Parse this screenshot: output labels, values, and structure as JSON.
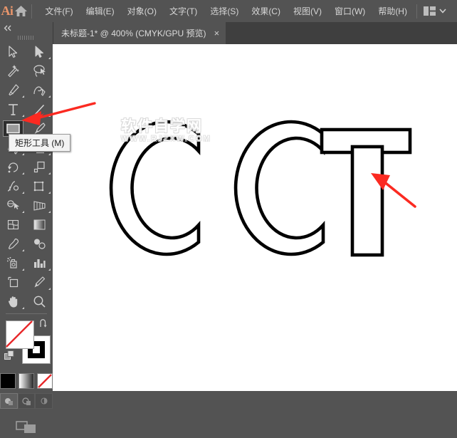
{
  "app": {
    "name": "Adobe Illustrator",
    "logo_text": "Ai",
    "home_icon": "home-icon"
  },
  "menubar": {
    "items": [
      {
        "label": "文件(F)",
        "name": "menu-file"
      },
      {
        "label": "编辑(E)",
        "name": "menu-edit"
      },
      {
        "label": "对象(O)",
        "name": "menu-object"
      },
      {
        "label": "文字(T)",
        "name": "menu-type"
      },
      {
        "label": "选择(S)",
        "name": "menu-select"
      },
      {
        "label": "效果(C)",
        "name": "menu-effect"
      },
      {
        "label": "视图(V)",
        "name": "menu-view"
      },
      {
        "label": "窗口(W)",
        "name": "menu-window"
      },
      {
        "label": "帮助(H)",
        "name": "menu-help"
      }
    ],
    "workspace_switcher_icon": "workspace-layout-icon",
    "workspace_chevron_icon": "chevron-down-icon"
  },
  "tabbar": {
    "document_title": "未标题-1* @ 400% (CMYK/GPU 预览)",
    "close_label": "×"
  },
  "toolpanel": {
    "collapse_icon": "double-chevron-left-icon",
    "grip_icon": "panel-grip-icon",
    "tools": [
      {
        "name": "selection-tool",
        "icon": "arrow-cursor-icon",
        "flyout": false,
        "active": false
      },
      {
        "name": "direct-selection-tool",
        "icon": "white-arrow-cursor-icon",
        "flyout": true,
        "active": false
      },
      {
        "name": "magic-wand-tool",
        "icon": "magic-wand-icon",
        "flyout": false,
        "active": false
      },
      {
        "name": "lasso-tool",
        "icon": "lasso-icon",
        "flyout": false,
        "active": false
      },
      {
        "name": "pen-tool",
        "icon": "pen-nib-icon",
        "flyout": true,
        "active": false
      },
      {
        "name": "curvature-tool",
        "icon": "curvature-pen-icon",
        "flyout": true,
        "active": false
      },
      {
        "name": "type-tool",
        "icon": "text-t-icon",
        "flyout": true,
        "active": false
      },
      {
        "name": "line-segment-tool",
        "icon": "line-diagonal-icon",
        "flyout": true,
        "active": false
      },
      {
        "name": "rectangle-tool",
        "icon": "rectangle-icon",
        "flyout": true,
        "active": true
      },
      {
        "name": "paintbrush-tool",
        "icon": "paintbrush-icon",
        "flyout": true,
        "active": false
      },
      {
        "name": "shaper-tool",
        "icon": "shaper-loop-icon",
        "flyout": true,
        "active": false
      },
      {
        "name": "eraser-tool",
        "icon": "eraser-icon",
        "flyout": true,
        "active": false
      },
      {
        "name": "rotate-tool",
        "icon": "rotate-icon",
        "flyout": true,
        "active": false
      },
      {
        "name": "scale-tool",
        "icon": "scale-icon",
        "flyout": true,
        "active": false
      },
      {
        "name": "width-tool",
        "icon": "width-icon",
        "flyout": true,
        "active": false
      },
      {
        "name": "free-transform-tool",
        "icon": "free-transform-icon",
        "flyout": true,
        "active": false
      },
      {
        "name": "shape-builder-tool",
        "icon": "shape-builder-icon",
        "flyout": true,
        "active": false
      },
      {
        "name": "perspective-grid-tool",
        "icon": "perspective-grid-icon",
        "flyout": true,
        "active": false
      },
      {
        "name": "mesh-tool",
        "icon": "mesh-icon",
        "flyout": false,
        "active": false
      },
      {
        "name": "gradient-tool",
        "icon": "gradient-icon",
        "flyout": false,
        "active": false
      },
      {
        "name": "eyedropper-tool",
        "icon": "eyedropper-icon",
        "flyout": true,
        "active": false
      },
      {
        "name": "blend-tool",
        "icon": "blend-icon",
        "flyout": false,
        "active": false
      },
      {
        "name": "symbol-sprayer-tool",
        "icon": "symbol-sprayer-icon",
        "flyout": true,
        "active": false
      },
      {
        "name": "column-graph-tool",
        "icon": "bar-chart-icon",
        "flyout": true,
        "active": false
      },
      {
        "name": "artboard-tool",
        "icon": "artboard-icon",
        "flyout": false,
        "active": false
      },
      {
        "name": "slice-tool",
        "icon": "slice-knife-icon",
        "flyout": true,
        "active": false
      },
      {
        "name": "hand-tool",
        "icon": "hand-icon",
        "flyout": true,
        "active": false
      },
      {
        "name": "zoom-tool",
        "icon": "magnifier-icon",
        "flyout": false,
        "active": false
      }
    ],
    "fill_swatch": {
      "name": "fill-swatch",
      "value": "none",
      "icon": "no-color-slash-icon"
    },
    "stroke_swatch": {
      "name": "stroke-swatch",
      "value": "#000000"
    },
    "swap_icon": "swap-fill-stroke-icon",
    "default_icon": "default-fill-stroke-icon",
    "color_modes": [
      {
        "name": "color-button",
        "icon": "solid-color-icon"
      },
      {
        "name": "gradient-button",
        "icon": "gradient-swatch-icon"
      },
      {
        "name": "none-button",
        "icon": "none-slash-icon"
      }
    ],
    "draw_modes": [
      {
        "name": "draw-normal-button",
        "icon": "draw-normal-icon",
        "selected": true
      },
      {
        "name": "draw-behind-button",
        "icon": "draw-behind-icon",
        "selected": false
      },
      {
        "name": "draw-inside-button",
        "icon": "draw-inside-icon",
        "selected": false
      }
    ],
    "screen_mode": {
      "name": "screen-mode-button",
      "icon": "screen-mode-icon"
    }
  },
  "tooltip": {
    "text": "矩形工具 (M)",
    "name": "rectangle-tool-tooltip"
  },
  "canvas": {
    "background": "#ffffff",
    "watermark": {
      "chinese": "软件自学网",
      "english": "WWW.RJZXW.COM"
    },
    "artwork": {
      "description": "CCT outlined letterforms",
      "stroke_color": "#000000",
      "fill": "none",
      "shapes": [
        {
          "name": "letter-c-outline-1",
          "type": "letter",
          "char": "C"
        },
        {
          "name": "letter-c-outline-2",
          "type": "letter",
          "char": "C"
        },
        {
          "name": "t-bar-rectangle",
          "type": "rectangle"
        },
        {
          "name": "t-stem-rectangle",
          "type": "rectangle"
        }
      ]
    }
  },
  "annotations": {
    "color": "#fb2a21",
    "arrows": [
      {
        "name": "arrow-to-rectangle-tool",
        "points_to": "rectangle-tool"
      },
      {
        "name": "arrow-to-t-stem",
        "points_to": "t-stem-rectangle"
      }
    ]
  }
}
